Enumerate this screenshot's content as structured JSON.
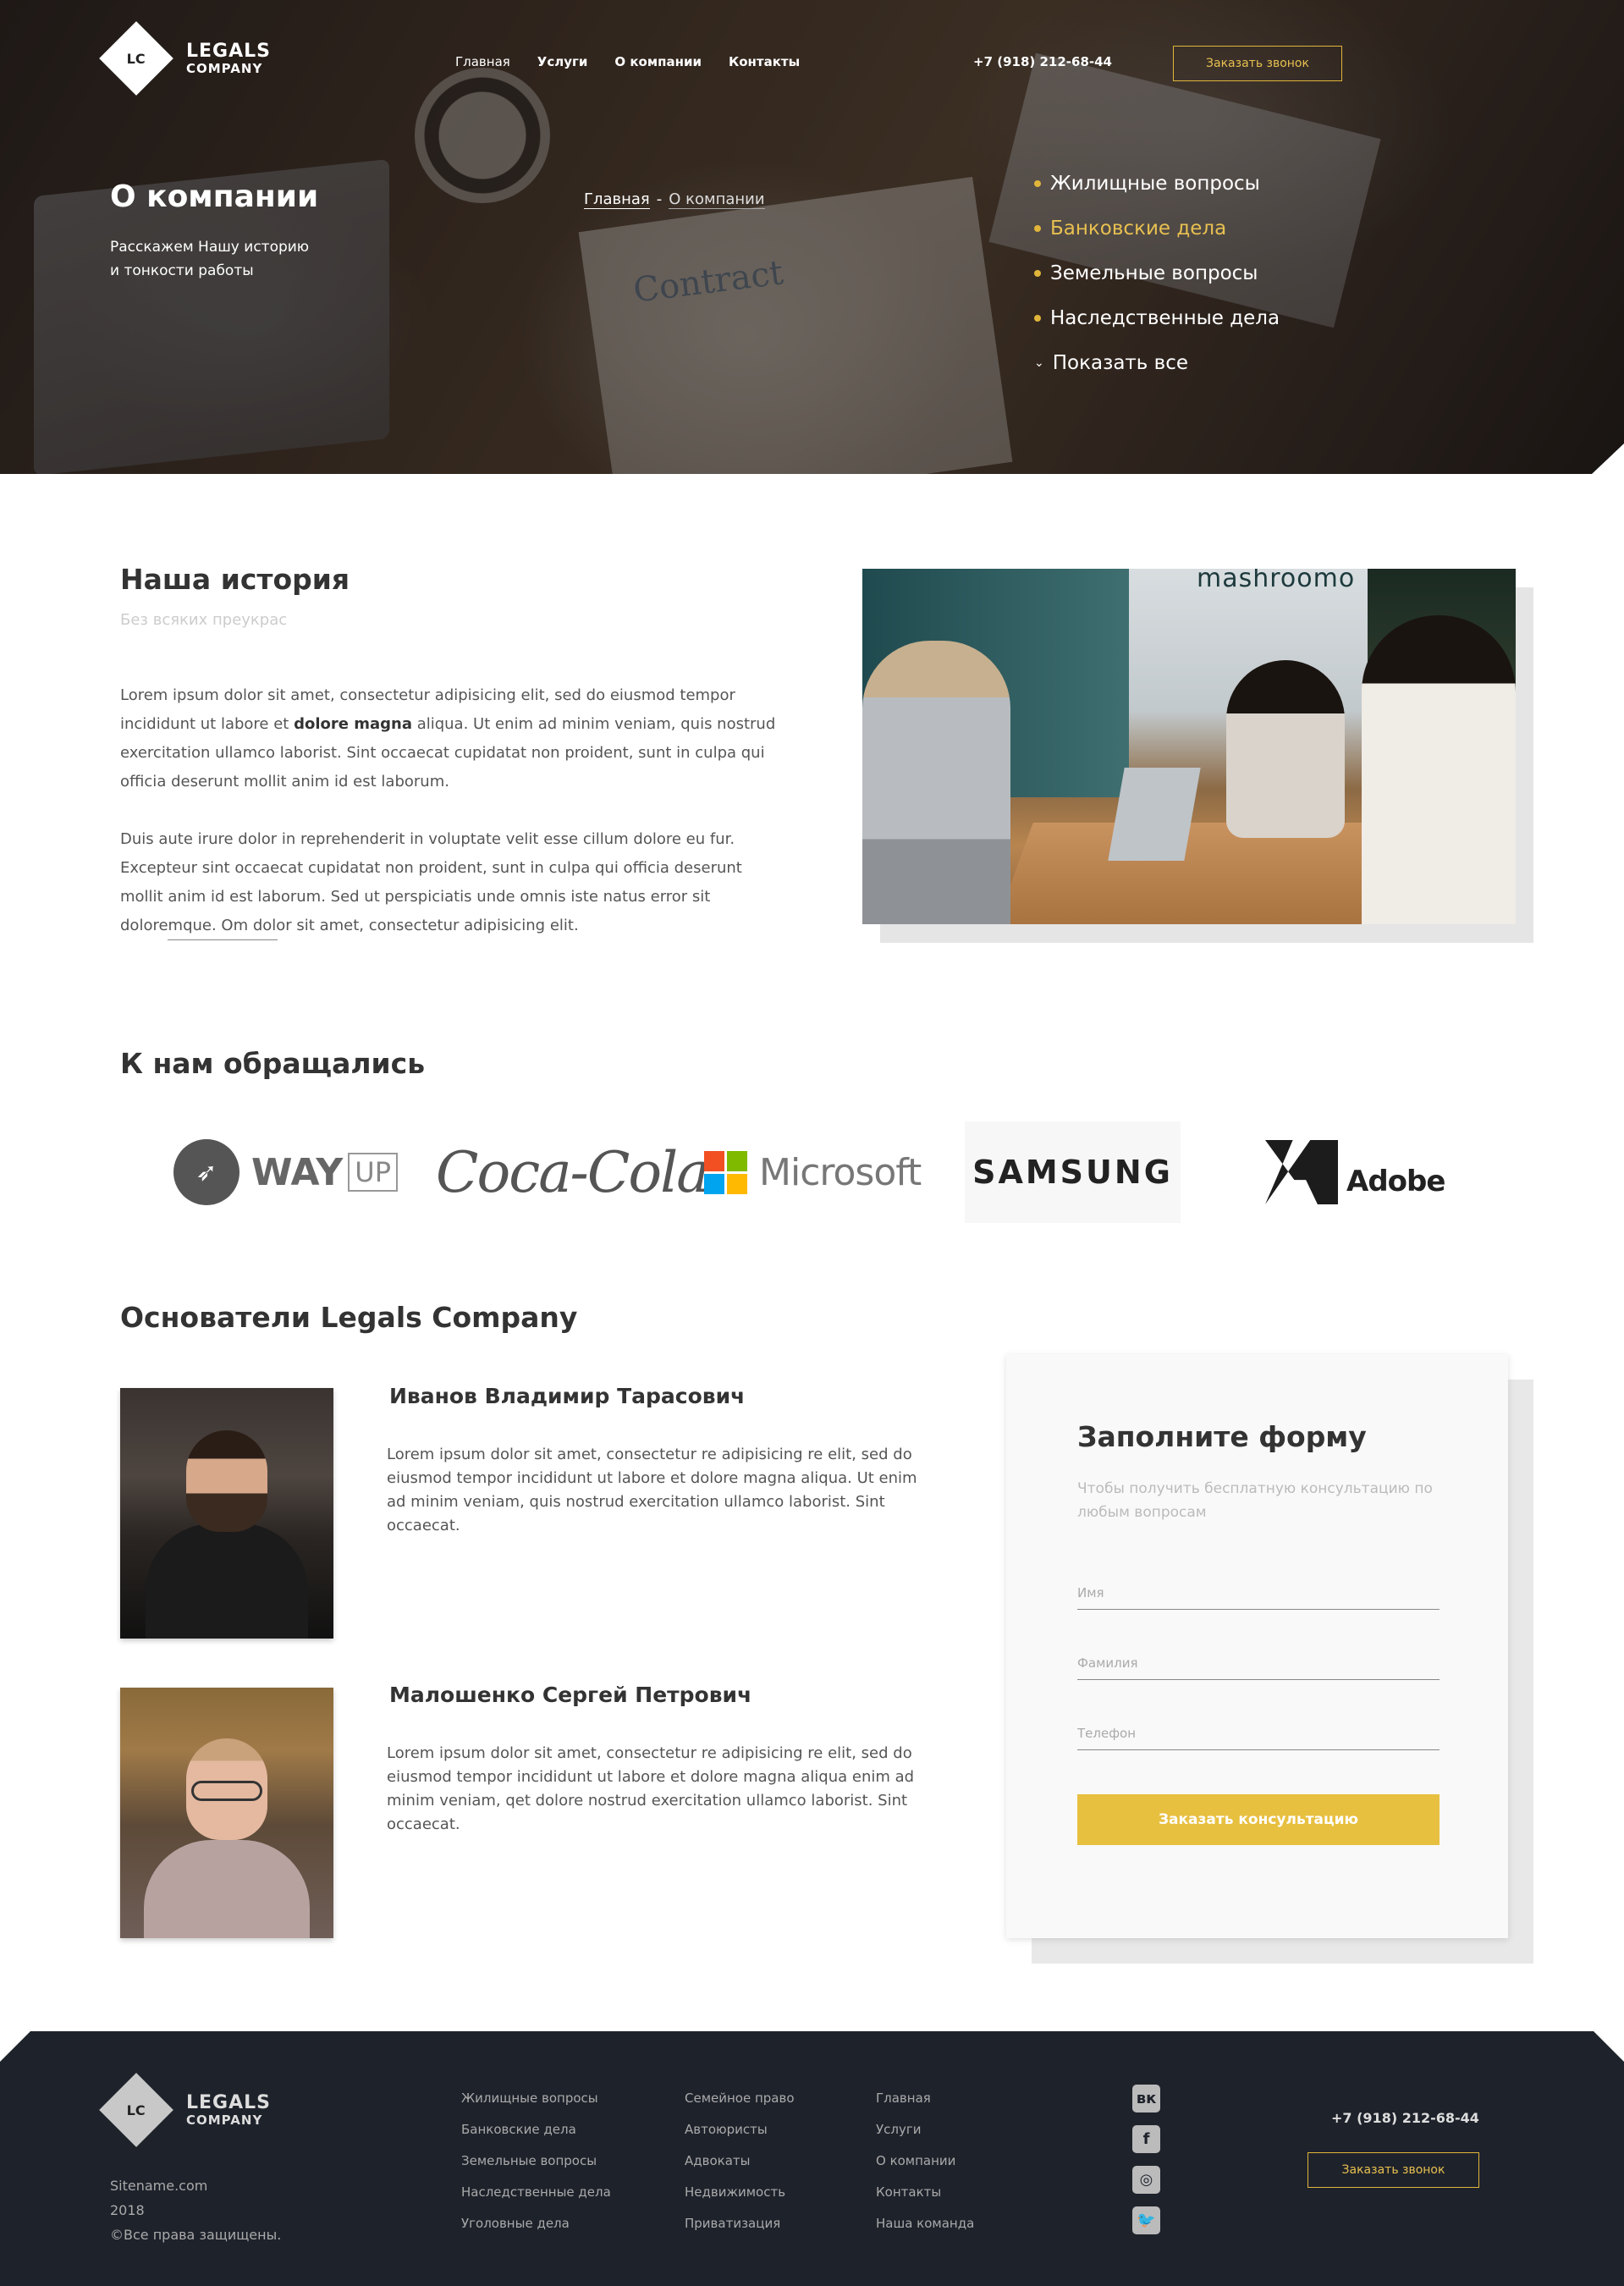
{
  "brand": {
    "initials": "LC",
    "name_line1": "LEGALS",
    "name_line2": "COMPANY"
  },
  "nav": [
    "Главная",
    "Услуги",
    "О компании",
    "Контакты"
  ],
  "header": {
    "phone": "+7 (918) 212-68-44",
    "callback_button": "Заказать звонок"
  },
  "hero": {
    "title": "О компании",
    "subtitle_line1": "Расскажем Нашу историю",
    "subtitle_line2": "и тонкости работы",
    "background_text": "Contract",
    "breadcrumb": {
      "home": "Главная",
      "separator": "-",
      "current": "О компании"
    },
    "services": [
      {
        "label": "Жилищные вопросы",
        "active": false
      },
      {
        "label": "Банковские дела",
        "active": true
      },
      {
        "label": "Земельные вопросы",
        "active": false
      },
      {
        "label": "Наследственные дела",
        "active": false
      }
    ],
    "show_all": "Показать все"
  },
  "story": {
    "title": "Наша история",
    "subtitle": "Без всяких преукрас",
    "p1_before": "Lorem ipsum dolor sit amet, consectetur adipisicing elit, sed do eiusmod tempor incididunt ut labore et ",
    "p1_bold": "dolore magna",
    "p1_after": " aliqua. Ut enim ad minim veniam, quis nostrud exercitation ullamco laborist. Sint occaecat cupidatat non proident, sunt in culpa qui officia deserunt mollit anim id est laborum.",
    "p2": "Duis aute irure dolor in reprehenderit in voluptate velit esse cillum dolore eu fur. Excepteur sint occaecat cupidatat non proident, sunt in culpa qui officia deserunt mollit anim id est laborum. Sed ut perspiciatis unde omnis iste natus error sit doloremque. Om dolor sit amet, consectetur adipisicing elit.",
    "image_sign": "mashroomo"
  },
  "clients": {
    "title": "К нам обращались",
    "logos": {
      "wayup_word": "WAY",
      "wayup_box": "UP",
      "coke": "Coca-Cola",
      "microsoft": "Microsoft",
      "samsung": "SAMSUNG",
      "adobe": "Adobe"
    },
    "ms_colors": [
      "#f25022",
      "#7fba00",
      "#00a4ef",
      "#ffb900"
    ]
  },
  "founders": {
    "title": "Основатели Legals Company",
    "people": [
      {
        "name": "Иванов Владимир Тарасович",
        "text": "Lorem ipsum dolor sit amet, consectetur re adipisicing re elit, sed do eiusmod tempor incididunt ut labore et dolore magna aliqua. Ut enim ad minim veniam, quis nostrud exercitation ullamco laborist. Sint occaecat."
      },
      {
        "name": "Малошенко Сергей Петрович",
        "text": "Lorem ipsum dolor sit amet, consectetur re adipisicing re elit, sed do eiusmod tempor incididunt ut labore et dolore magna aliqua enim ad minim veniam, qet dolore  nostrud exercitation ullamco laborist. Sint occaecat."
      }
    ]
  },
  "form": {
    "title": "Заполните форму",
    "subtitle": "Чтобы получить бесплатную консультацию по любым вопросам",
    "name_placeholder": "Имя",
    "surname_placeholder": "Фамилия",
    "phone_placeholder": "Телефон",
    "submit": "Заказать консультацию"
  },
  "footer": {
    "site": "Sitename.com",
    "year": "2018",
    "rights": "©Все права защищены.",
    "col1": [
      "Жилищные вопросы",
      "Банковские дела",
      "Земельные вопросы",
      "Наследственные дела",
      "Уголовные дела"
    ],
    "col2": [
      "Семейное право",
      "Автоюристы",
      "Адвокаты",
      "Недвижимость",
      "Приватизация"
    ],
    "col3": [
      "Главная",
      "Услуги",
      "О компании",
      "Контакты",
      "Наша команда"
    ],
    "social": [
      "vk-icon",
      "facebook-icon",
      "instagram-icon",
      "twitter-icon"
    ],
    "phone": "+7 (918) 212-68-44",
    "callback_button": "Заказать звонок"
  },
  "colors": {
    "accent": "#e8c040",
    "footer_bg": "#1e222b",
    "text": "#333333"
  }
}
